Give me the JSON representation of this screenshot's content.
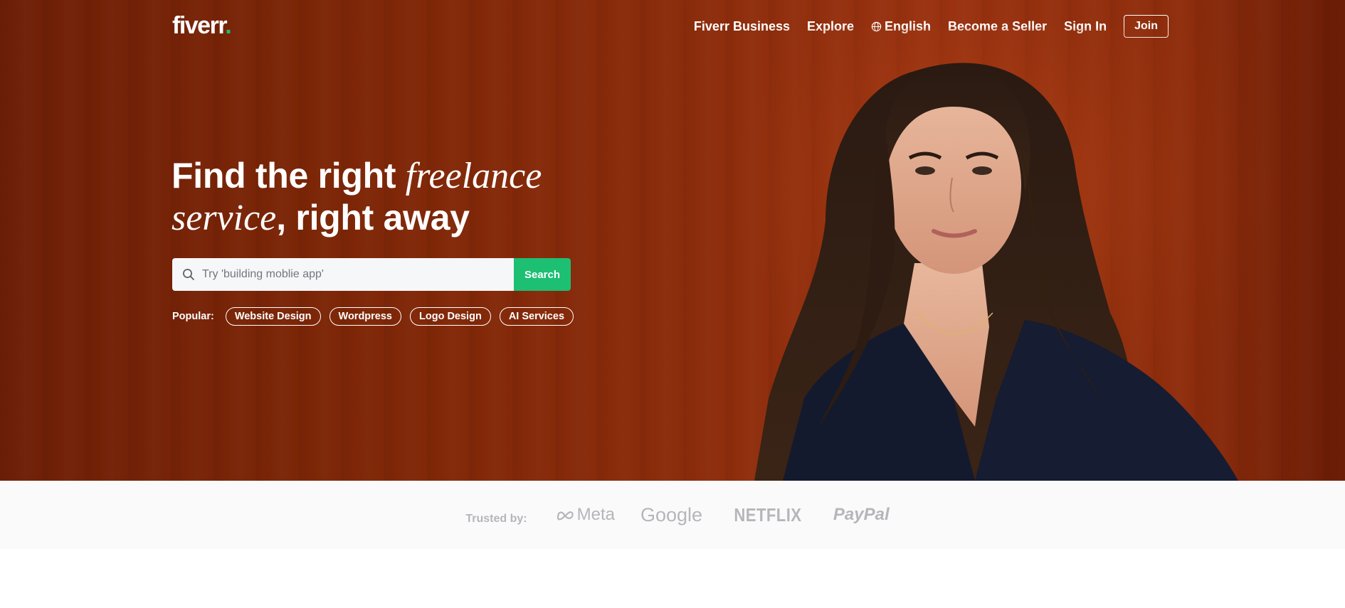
{
  "header": {
    "logo_text": "fiverr",
    "logo_dot": ".",
    "nav": {
      "business": "Fiverr Business",
      "explore": "Explore",
      "language": "English",
      "become_seller": "Become a Seller",
      "sign_in": "Sign In",
      "join": "Join"
    }
  },
  "hero": {
    "headline_part1": "Find the right ",
    "headline_italic1": "freelance",
    "headline_italic2": "service",
    "headline_part2": ", right away",
    "search": {
      "placeholder": "Try 'building moblie app'",
      "button": "Search"
    },
    "popular": {
      "label": "Popular:",
      "chips": [
        "Website Design",
        "Wordpress",
        "Logo Design",
        "AI Services"
      ]
    }
  },
  "trusted": {
    "label": "Trusted by:",
    "brands": [
      "Meta",
      "Google",
      "NETFLIX",
      "PayPal"
    ]
  },
  "colors": {
    "hero_bg": "#7d2607",
    "accent_green": "#1dbf73",
    "trusted_bg": "#fafafa",
    "brand_gray": "#b5b6ba"
  }
}
